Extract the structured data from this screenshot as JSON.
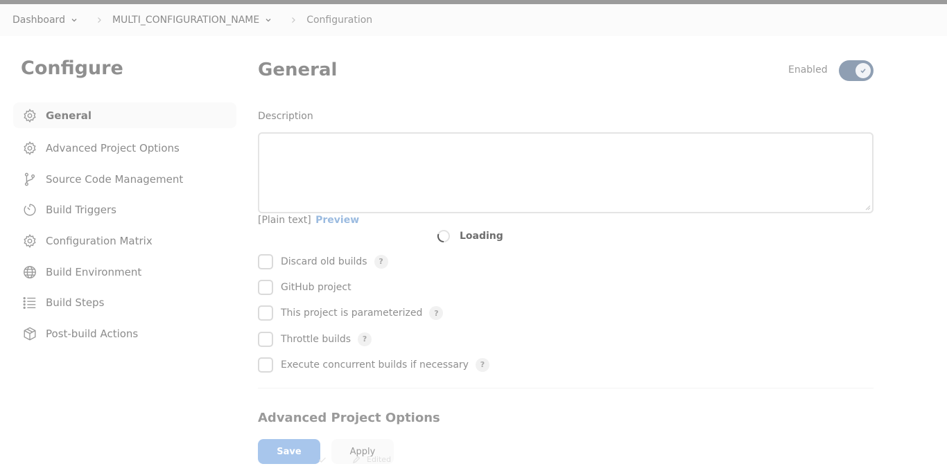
{
  "breadcrumbs": [
    {
      "label": "Dashboard",
      "dropdown": true
    },
    {
      "label": "MULTI_CONFIGURATION_NAME",
      "dropdown": true
    },
    {
      "label": "Configuration",
      "dropdown": false
    }
  ],
  "sidebar": {
    "title": "Configure",
    "items": [
      {
        "label": "General",
        "icon": "gear-icon",
        "active": true
      },
      {
        "label": "Advanced Project Options",
        "icon": "gear-icon",
        "active": false
      },
      {
        "label": "Source Code Management",
        "icon": "git-branch-icon",
        "active": false
      },
      {
        "label": "Build Triggers",
        "icon": "timer-icon",
        "active": false
      },
      {
        "label": "Configuration Matrix",
        "icon": "gear-icon",
        "active": false
      },
      {
        "label": "Build Environment",
        "icon": "globe-icon",
        "active": false
      },
      {
        "label": "Build Steps",
        "icon": "list-icon",
        "active": false
      },
      {
        "label": "Post-build Actions",
        "icon": "package-icon",
        "active": false
      }
    ]
  },
  "main": {
    "title": "General",
    "enabled_label": "Enabled",
    "enabled": true,
    "description_label": "Description",
    "description_value": "",
    "syntax_label": "[Plain text]",
    "preview_label": "Preview",
    "loading_label": "Loading",
    "options": [
      {
        "label": "Discard old builds",
        "checked": false,
        "help": "?"
      },
      {
        "label": "GitHub project",
        "checked": false,
        "help": ""
      },
      {
        "label": "This project is parameterized",
        "checked": false,
        "help": "?"
      },
      {
        "label": "Throttle builds",
        "checked": false,
        "help": "?"
      },
      {
        "label": "Execute concurrent builds if necessary",
        "checked": false,
        "help": "?"
      }
    ],
    "next_section_title": "Advanced Project Options"
  },
  "footer": {
    "save_label": "Save",
    "apply_label": "Apply",
    "edited_label": "Edited"
  },
  "colors": {
    "accent": "#a8c6ec",
    "toggle_on": "#8f9fb3"
  }
}
